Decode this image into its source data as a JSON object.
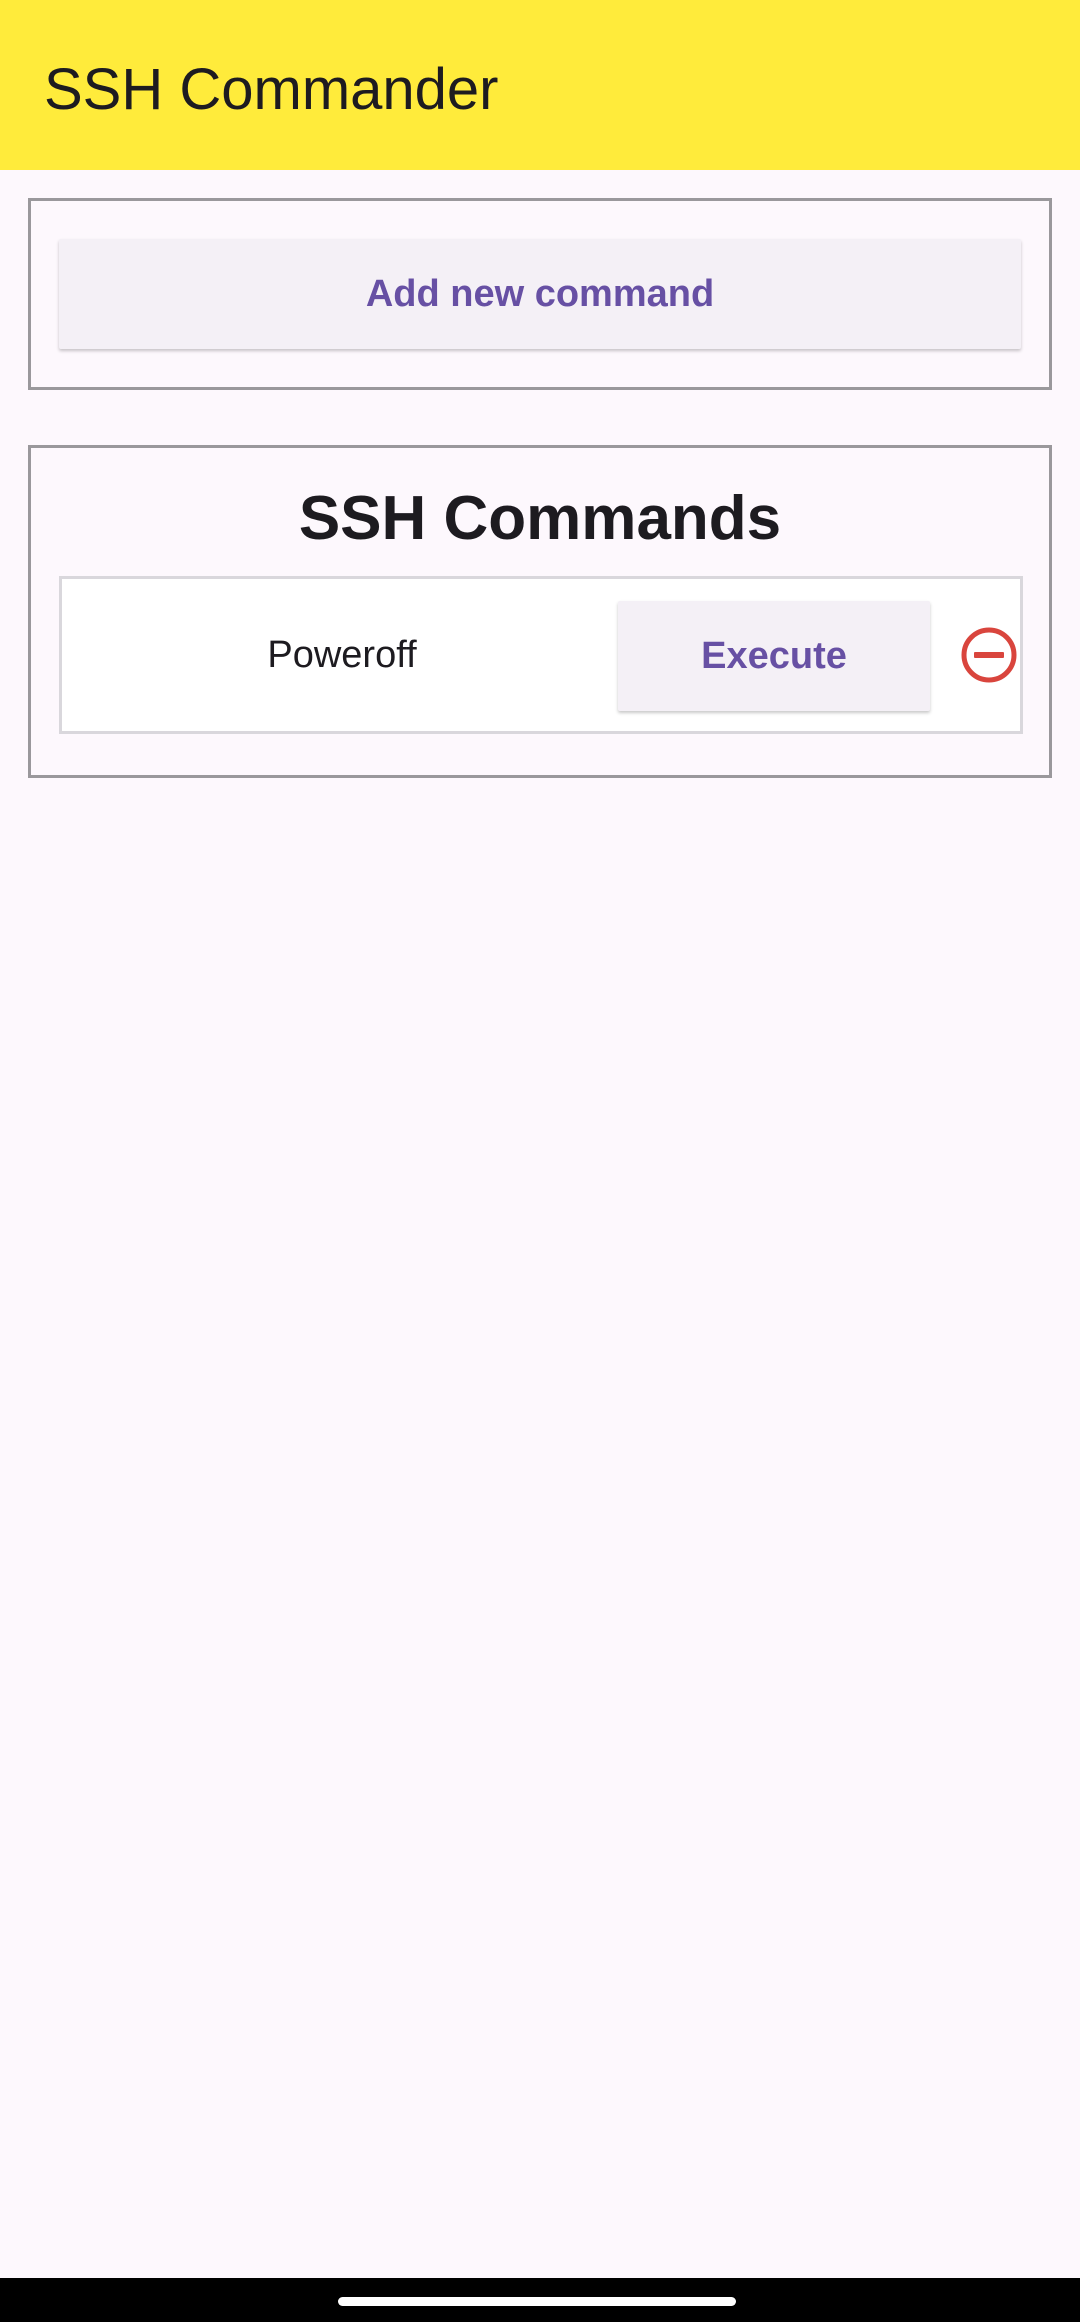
{
  "app_bar": {
    "title": "SSH Commander",
    "color": "#ffeb3b"
  },
  "add_section": {
    "button_label": "Add new command"
  },
  "commands_section": {
    "title": "SSH Commands",
    "items": [
      {
        "name": "Poweroff",
        "execute_label": "Execute",
        "delete_icon": "remove-circle-outline-icon"
      }
    ]
  },
  "colors": {
    "accent": "#6750a4",
    "danger": "#d9453d",
    "background": "#fdf8fd"
  }
}
